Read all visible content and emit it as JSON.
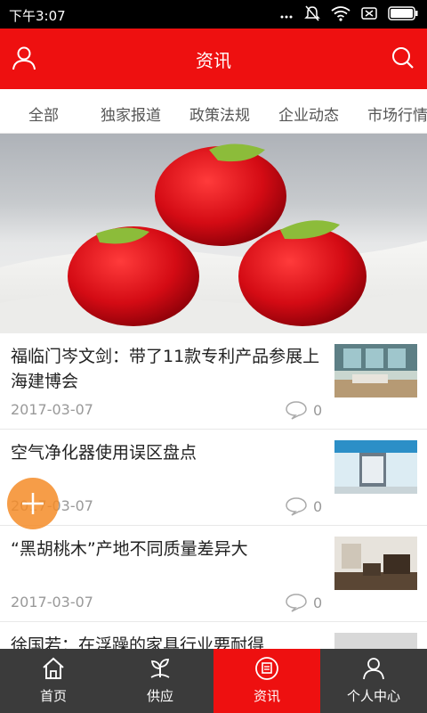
{
  "status_bar": {
    "time": "下午3:07"
  },
  "header": {
    "title": "资讯"
  },
  "tabs": [
    "全部",
    "独家报道",
    "政策法规",
    "企业动态",
    "市场行情"
  ],
  "news": [
    {
      "title": "福临门岑文剑：带了11款专利产品参展上海建博会",
      "date": "2017-03-07",
      "comments": "0"
    },
    {
      "title": "空气净化器使用误区盘点",
      "date": "2017-03-07",
      "comments": "0"
    },
    {
      "title": "“黑胡桃木”产地不同质量差异大",
      "date": "2017-03-07",
      "comments": "0"
    },
    {
      "title": "徐国若：在浮躁的家具行业要耐得",
      "date": "",
      "comments": ""
    }
  ],
  "bottom_nav": [
    {
      "label": "首页",
      "icon": "home-icon"
    },
    {
      "label": "供应",
      "icon": "supply-icon"
    },
    {
      "label": "资讯",
      "icon": "news-icon"
    },
    {
      "label": "个人中心",
      "icon": "user-icon"
    }
  ],
  "colors": {
    "brand": "#ee1010",
    "nav_bg": "#3b3b3b",
    "fab": "#f58c28"
  }
}
